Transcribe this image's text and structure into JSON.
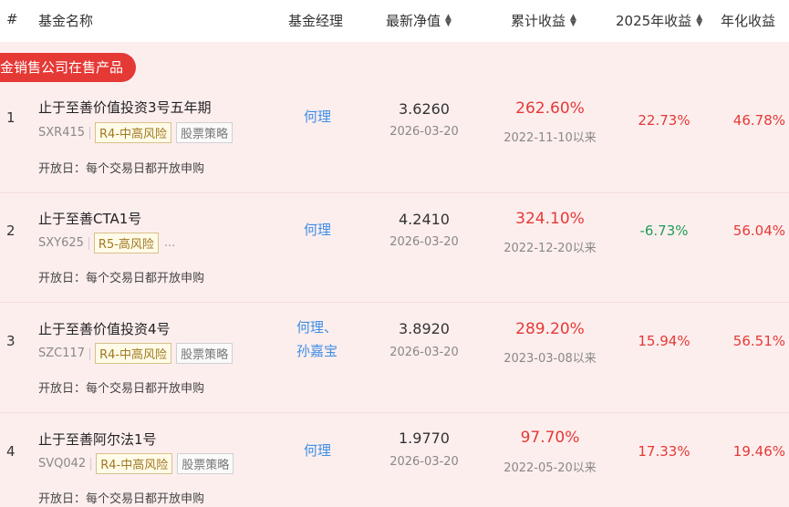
{
  "header": {
    "idx": "#",
    "name": "基金名称",
    "manager": "基金经理",
    "nav": "最新净值",
    "cumulative": "累计收益",
    "ytd": "2025年收益",
    "annualized": "年化收益",
    "sort_up": "▲",
    "sort_down": "▼"
  },
  "section_tag": "金销售公司在售产品",
  "rows": [
    {
      "idx": "1",
      "name": "止于至善价值投资3号五年期",
      "code": "SXR415",
      "risk": "R4-中高风险",
      "strategy": "股票策略",
      "more": "",
      "manager_1": "何理",
      "manager_2": "",
      "open_day": "开放日：每个交易日都开放申购",
      "nav": "3.6260",
      "nav_date": "2026-03-20",
      "cumulative": "262.60%",
      "since": "2022-11-10以来",
      "ytd": "22.73%",
      "ytd_color": "red",
      "annualized": "46.78%"
    },
    {
      "idx": "2",
      "name": "止于至善CTA1号",
      "code": "SXY625",
      "risk": "R5-高风险",
      "strategy": "",
      "more": "...",
      "manager_1": "何理",
      "manager_2": "",
      "open_day": "开放日：每个交易日都开放申购",
      "nav": "4.2410",
      "nav_date": "2026-03-20",
      "cumulative": "324.10%",
      "since": "2022-12-20以来",
      "ytd": "-6.73%",
      "ytd_color": "green",
      "annualized": "56.04%"
    },
    {
      "idx": "3",
      "name": "止于至善价值投资4号",
      "code": "SZC117",
      "risk": "R4-中高风险",
      "strategy": "股票策略",
      "more": "",
      "manager_1": "何理、",
      "manager_2": "孙嘉宝",
      "open_day": "开放日：每个交易日都开放申购",
      "nav": "3.8920",
      "nav_date": "2026-03-20",
      "cumulative": "289.20%",
      "since": "2023-03-08以来",
      "ytd": "15.94%",
      "ytd_color": "red",
      "annualized": "56.51%"
    },
    {
      "idx": "4",
      "name": "止于至善阿尔法1号",
      "code": "SVQ042",
      "risk": "R4-中高风险",
      "strategy": "股票策略",
      "more": "",
      "manager_1": "何理",
      "manager_2": "",
      "open_day": "开放日：每个交易日都开放申购",
      "nav": "1.9770",
      "nav_date": "2026-03-20",
      "cumulative": "97.70%",
      "since": "2022-05-20以来",
      "ytd": "17.33%",
      "ytd_color": "red",
      "annualized": "19.46%"
    }
  ]
}
